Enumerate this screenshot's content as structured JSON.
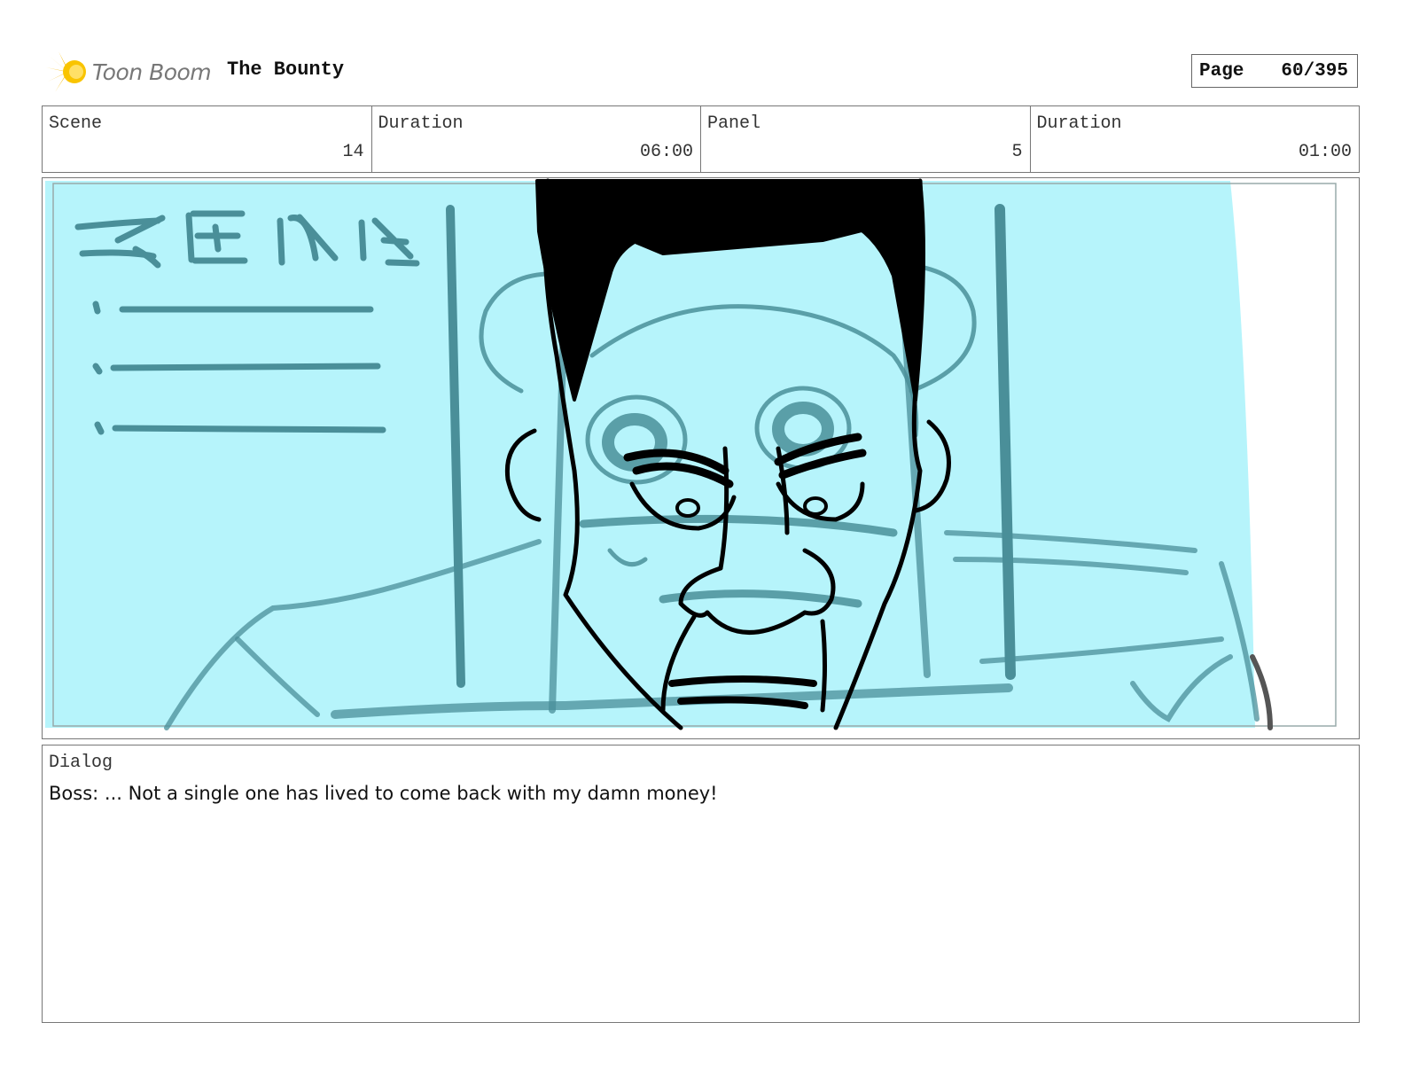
{
  "header": {
    "logo_text": "Toon Boom",
    "project_title": "The Bounty",
    "page_label": "Page",
    "page_value": "60/395"
  },
  "info": {
    "scene_label": "Scene",
    "scene_value": "14",
    "scene_duration_label": "Duration",
    "scene_duration_value": "06:00",
    "panel_label": "Panel",
    "panel_value": "5",
    "panel_duration_label": "Duration",
    "panel_duration_value": "01:00"
  },
  "dialog": {
    "label": "Dialog",
    "text": "Boss: ... Not a single one has lived to come back with my damn money!"
  },
  "colors": {
    "screen": "#b6f4fb",
    "sketch_teal": "#4a8f99",
    "ink": "#000000",
    "logo_yellow": "#f6b800"
  }
}
